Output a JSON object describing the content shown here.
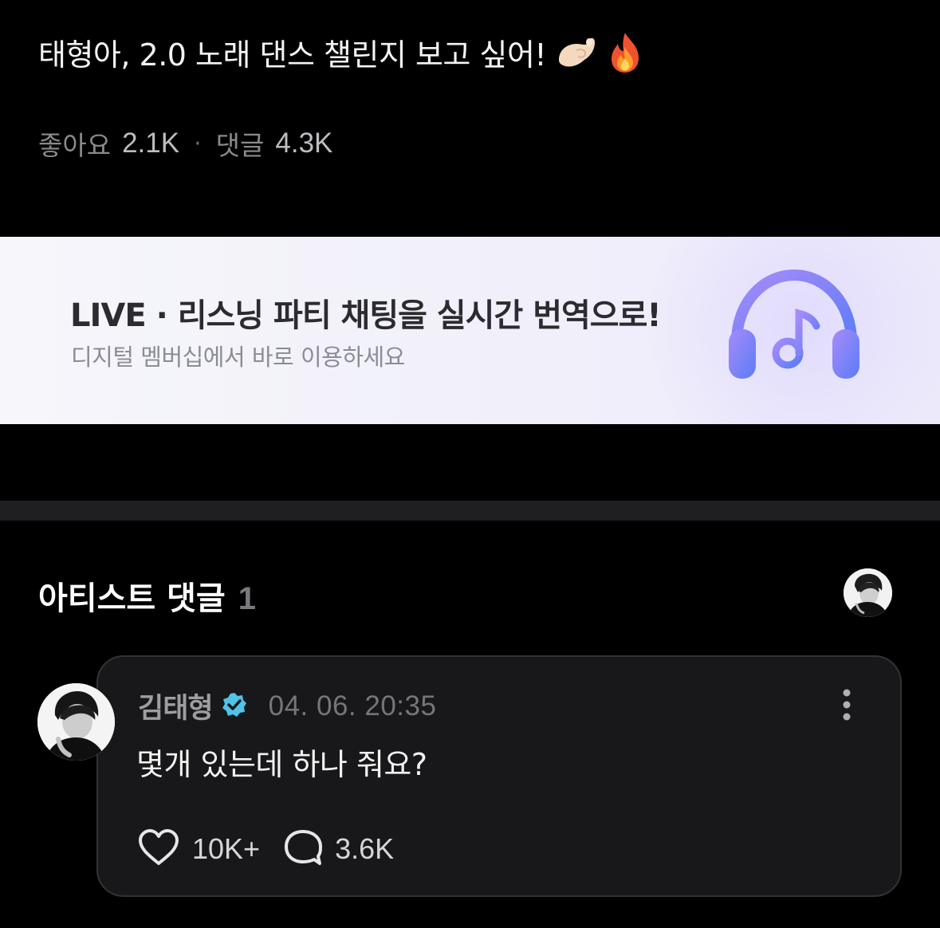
{
  "post": {
    "title": "태형아, 2.0 노래 댄스 챌린지 보고 싶어!",
    "emoji": [
      "pinching-hand-icon",
      "fire-icon"
    ],
    "likes_label": "좋아요",
    "likes_value": "2.1K",
    "separator": "·",
    "comments_label": "댓글",
    "comments_value": "4.3K"
  },
  "banner": {
    "title": "LIVE · 리스닝 파티 채팅을 실시간 번역으로!",
    "subtitle": "디지털 멤버십에서 바로 이용하세요",
    "icon": "headphones-music-icon"
  },
  "artist_comments": {
    "title": "아티스트 댓글",
    "count": "1"
  },
  "comment": {
    "author": "김태형",
    "timestamp": "04. 06. 20:35",
    "text": "몇개 있는데 하나 줘요?",
    "likes": "10K+",
    "replies": "3.6K"
  },
  "colors": {
    "background": "#000000",
    "card": "#18181a",
    "verified": "#4fc3e8",
    "headphone_accent": "#7b6cf2"
  }
}
